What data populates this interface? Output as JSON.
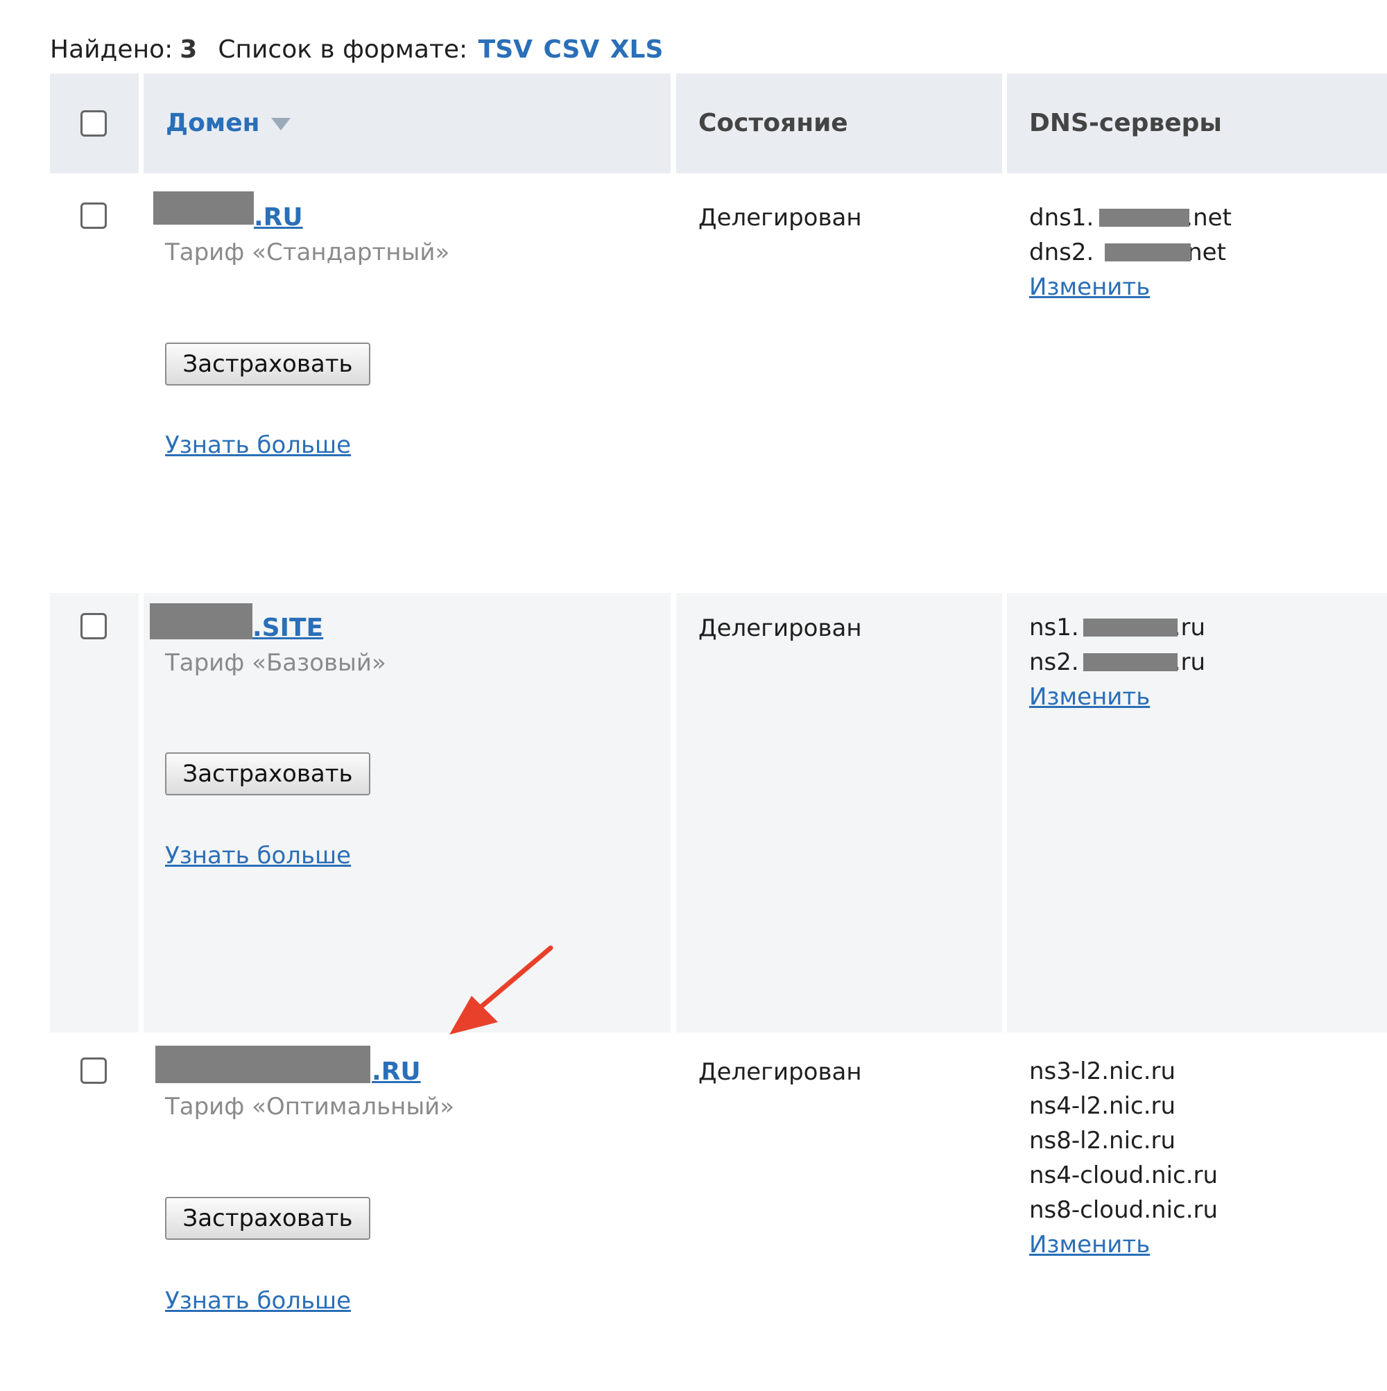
{
  "summary": {
    "found_label": "Найдено:",
    "found_count": "3",
    "format_label": "Список в формате:",
    "formats": [
      "TSV",
      "CSV",
      "XLS"
    ]
  },
  "table": {
    "headers": {
      "domain": "Домен",
      "status": "Состояние",
      "dns": "DNS-серверы"
    },
    "rows": [
      {
        "domain_suffix": ".RU",
        "tariff": "Тариф «Стандартный»",
        "status": "Делегирован",
        "dns": [
          {
            "prefix": "dns1.",
            "suffix": ".net"
          },
          {
            "prefix": "dns2.",
            "suffix": ".net"
          }
        ],
        "change_label": "Изменить",
        "insure_label": "Застраховать",
        "more_label": "Узнать больше"
      },
      {
        "domain_suffix": ".SITE",
        "tariff": "Тариф «Базовый»",
        "status": "Делегирован",
        "dns": [
          {
            "prefix": "ns1.",
            "suffix": ".ru"
          },
          {
            "prefix": "ns2.",
            "suffix": ".ru"
          }
        ],
        "change_label": "Изменить",
        "insure_label": "Застраховать",
        "more_label": "Узнать больше"
      },
      {
        "domain_suffix": ".RU",
        "tariff": "Тариф «Оптимальный»",
        "status": "Делегирован",
        "dns": [
          {
            "prefix": "ns3-l2.nic.ru",
            "suffix": ""
          },
          {
            "prefix": "ns4-l2.nic.ru",
            "suffix": ""
          },
          {
            "prefix": "ns8-l2.nic.ru",
            "suffix": ""
          },
          {
            "prefix": "ns4-cloud.nic.ru",
            "suffix": ""
          },
          {
            "prefix": "ns8-cloud.nic.ru",
            "suffix": ""
          }
        ],
        "change_label": "Изменить",
        "insure_label": "Застраховать",
        "more_label": "Узнать больше"
      }
    ]
  },
  "colors": {
    "link": "#2a6fb7",
    "header_bg": "#e9edf2",
    "row_shade": "#f4f5f6",
    "annotation_arrow": "#e8402a"
  }
}
